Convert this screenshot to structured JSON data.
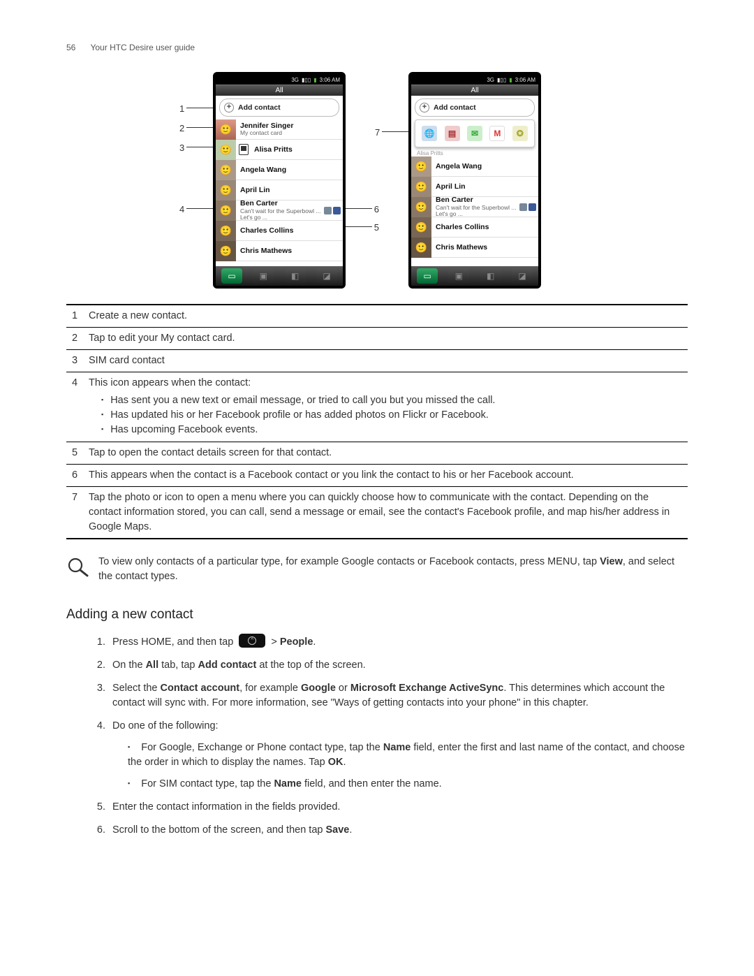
{
  "page": {
    "number": "56",
    "title": "Your HTC Desire user guide"
  },
  "status": {
    "net": "3G",
    "time": "3:06 AM"
  },
  "tab": "All",
  "addContact": "Add contact",
  "contactsA": [
    {
      "name": "Jennifer Singer",
      "sub": "My contact card"
    },
    {
      "name": "Alisa Pritts",
      "sim": true
    },
    {
      "name": "Angela Wang"
    },
    {
      "name": "April Lin"
    },
    {
      "name": "Ben Carter",
      "sub": "Can't wait for the Superbowl ... Let's go ...",
      "notif": true,
      "fb": true
    },
    {
      "name": "Charles Collins"
    },
    {
      "name": "Chris Mathews"
    }
  ],
  "remnantName": "Alisa Pritts",
  "contactsB": [
    {
      "name": "Angela Wang"
    },
    {
      "name": "April Lin"
    },
    {
      "name": "Ben Carter",
      "sub": "Can't wait for the Superbowl ... Let's go ...",
      "notif": true,
      "fb": true
    },
    {
      "name": "Charles Collins"
    },
    {
      "name": "Chris Mathews"
    }
  ],
  "callouts": {
    "1": "1",
    "2": "2",
    "3": "3",
    "4": "4",
    "5": "5",
    "6": "6",
    "7": "7"
  },
  "legend": {
    "1": "Create a new contact.",
    "2": "Tap to edit your My contact card.",
    "3": "SIM card contact",
    "4": "This icon appears when the contact:",
    "4a": "Has sent you a new text or email message, or tried to call you but you missed the call.",
    "4b": "Has updated his or her Facebook profile or has added photos on Flickr or Facebook.",
    "4c": "Has upcoming Facebook events.",
    "5": "Tap to open the contact details screen for that contact.",
    "6": "This appears when the contact is a Facebook contact or you link the contact to his or her Facebook account.",
    "7": "Tap the photo or icon to open a menu where you can quickly choose how to communicate with the contact. Depending on the contact information stored, you can call, send a message or email, see the contact's Facebook profile, and map his/her address in Google Maps."
  },
  "tip": {
    "a": "To view only contacts of a particular type, for example Google contacts or Facebook contacts, press MENU, tap ",
    "b": "View",
    "c": ", and select the contact types."
  },
  "section": "Adding a new contact",
  "steps": {
    "s1a": "Press HOME, and then tap ",
    "s1b": " > ",
    "s1c": "People",
    "s1d": ".",
    "s2a": "On the ",
    "s2b": "All",
    "s2c": " tab, tap ",
    "s2d": "Add contact",
    "s2e": " at the top of the screen.",
    "s3a": "Select the ",
    "s3b": "Contact account",
    "s3c": ", for example ",
    "s3d": "Google",
    "s3e": " or ",
    "s3f": "Microsoft Exchange ActiveSync",
    "s3g": ". This determines which account the contact will sync with. For more information, see \"Ways of getting contacts into your phone\" in this chapter.",
    "s4": "Do one of the following:",
    "s4a1": "For Google, Exchange or Phone contact type, tap the ",
    "s4a2": "Name",
    "s4a3": " field, enter the first and last name of the contact, and choose the order in which to display the names. Tap ",
    "s4a4": "OK",
    "s4a5": ".",
    "s4b1": "For SIM contact type, tap the ",
    "s4b2": "Name",
    "s4b3": " field, and then enter the name.",
    "s5": "Enter the contact information in the fields provided.",
    "s6a": "Scroll to the bottom of the screen, and then tap ",
    "s6b": "Save",
    "s6c": "."
  }
}
